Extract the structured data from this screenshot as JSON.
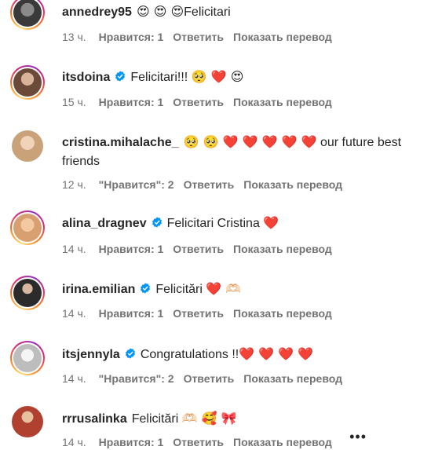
{
  "comments": [
    {
      "username": "annedrey95",
      "verified": false,
      "emoji_before": "😍 😍 😍",
      "text": "Felicitari",
      "emoji_after": "",
      "time": "13 ч.",
      "likes": "Нравится: 1",
      "reply": "Ответить",
      "translate": "Показать перевод",
      "avatar_color": "#3a3a3a"
    },
    {
      "username": "itsdoina",
      "verified": true,
      "emoji_before": "",
      "text": "Felicitari!!!",
      "emoji_after": "🥺 ❤️ 😍",
      "time": "15 ч.",
      "likes": "Нравится: 1",
      "reply": "Ответить",
      "translate": "Показать перевод",
      "avatar_color": "#6b4a3a"
    },
    {
      "username": "cristina.mihalache_",
      "verified": false,
      "emoji_before": "🥺 🥺 ❤️ ❤️ ❤️ ❤️ ❤️",
      "text": "our future best friends",
      "emoji_after": "",
      "time": "12 ч.",
      "likes": "\"Нравится\": 2",
      "reply": "Ответить",
      "translate": "Показать перевод",
      "avatar_color": "#c9a27a"
    },
    {
      "username": "alina_dragnev",
      "verified": true,
      "emoji_before": "",
      "text": "Felicitari Cristina",
      "emoji_after": "❤️",
      "time": "14 ч.",
      "likes": "Нравится: 1",
      "reply": "Ответить",
      "translate": "Показать перевод",
      "avatar_color": "#d8a070"
    },
    {
      "username": "irina.emilian",
      "verified": true,
      "emoji_before": "",
      "text": "Felicitări",
      "emoji_after": "❤️ 🫶🏻",
      "time": "14 ч.",
      "likes": "Нравится: 1",
      "reply": "Ответить",
      "translate": "Показать перевод",
      "avatar_color": "#2b2b2b"
    },
    {
      "username": "itsjennyla",
      "verified": true,
      "emoji_before": "",
      "text": "Congratulations !!",
      "emoji_after": "❤️ ❤️ ❤️ ❤️",
      "time": "14 ч.",
      "likes": "\"Нравится\": 2",
      "reply": "Ответить",
      "translate": "Показать перевод",
      "avatar_color": "#d0d0d0"
    },
    {
      "username": "rrrusalinka",
      "verified": false,
      "emoji_before": "",
      "text": "Felicitări",
      "emoji_after": "🫶🏻 🥰 🎀",
      "time": "14 ч.",
      "likes": "Нравится: 1",
      "reply": "Ответить",
      "translate": "Показать перевод",
      "avatar_color": "#b04030"
    }
  ],
  "colors": {
    "verified": "#0095f6",
    "meta_text": "#737373",
    "heart": "#ed1c24"
  }
}
